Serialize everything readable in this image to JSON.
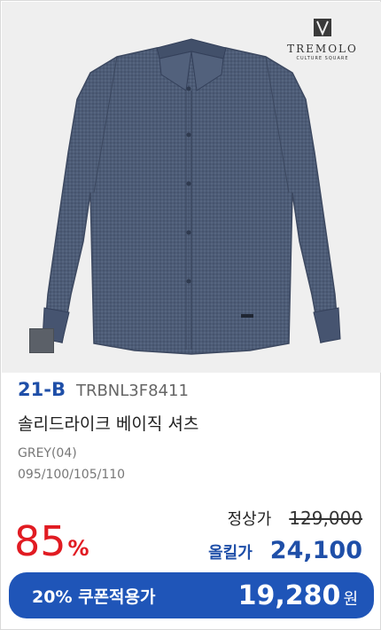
{
  "brand": {
    "name": "TREMOLO",
    "subtitle": "CULTURE SQUARE"
  },
  "product": {
    "brand_code": "21-B",
    "product_code": "TRBNL3F8411",
    "name": "솔리드라이크 베이직 셔츠",
    "color": "GREY(04)",
    "sizes": "095/100/105/110",
    "swatch_color": "#5b6068"
  },
  "pricing": {
    "discount_rate": "85",
    "discount_unit": "%",
    "regular_label": "정상가",
    "regular_price": "129,000",
    "sale_label": "올킬가",
    "sale_price": "24,100"
  },
  "coupon": {
    "label": "20% 쿠폰적용가",
    "price": "19,280",
    "currency": "원"
  },
  "colors": {
    "accent_blue": "#1f4fa8",
    "discount_red": "#e11b22",
    "coupon_bg": "#1f55b8"
  }
}
